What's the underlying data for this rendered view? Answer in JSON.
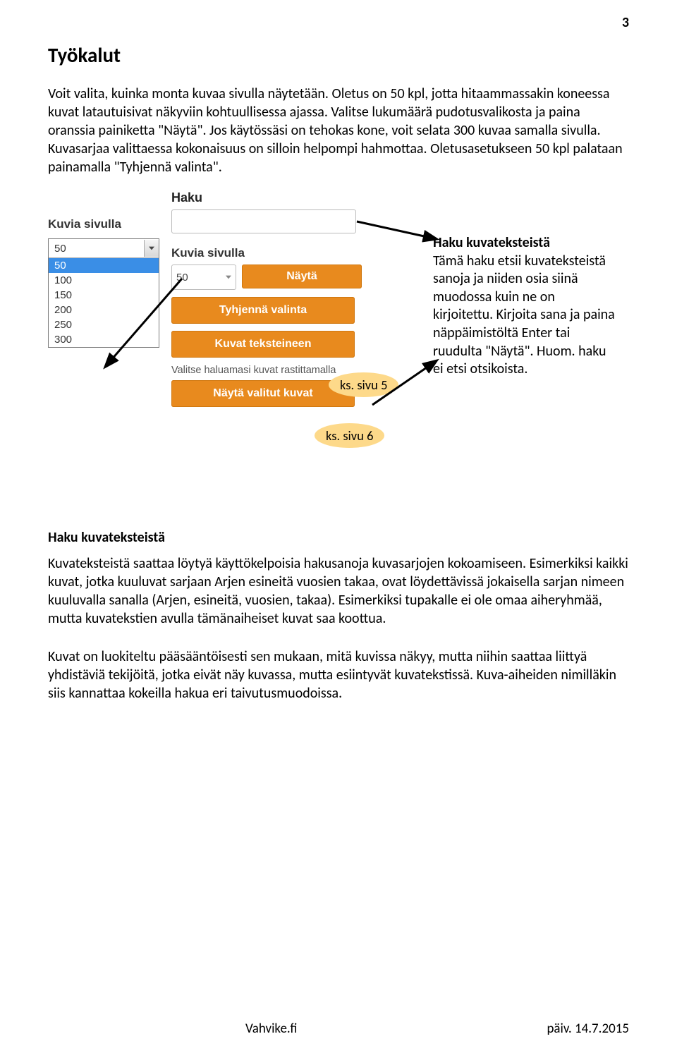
{
  "page_number": "3",
  "title": "Työkalut",
  "intro": "Voit valita, kuinka monta kuvaa sivulla näytetään. Oletus on 50 kpl, jotta hitaammassakin koneessa kuvat latautuisivat näkyviin kohtuullisessa ajassa. Valitse lukumäärä pudotusvalikosta ja paina oranssia painiketta \"Näytä\". Jos käytössäsi on tehokas kone, voit selata 300 kuvaa samalla sivulla. Kuvasarjaa valittaessa kokonaisuus on silloin helpompi hahmottaa. Oletusasetukseen 50 kpl palataan painamalla \"Tyhjennä valinta\".",
  "figure": {
    "left_label": "Kuvia sivulla",
    "select_value": "50",
    "options": [
      "50",
      "100",
      "150",
      "200",
      "250",
      "300"
    ],
    "haku_label": "Haku",
    "col_label": "Kuvia sivulla",
    "ctrl_select_value": "50",
    "btn_nayta": "Näytä",
    "btn_tyhjenna": "Tyhjennä valinta",
    "btn_kuvat_teksteineen": "Kuvat teksteineen",
    "helper": "Valitse haluamasi kuvat rastittamalla",
    "btn_nayta_valitut": "Näytä valitut kuvat",
    "callout1": "ks. sivu 5",
    "callout2": "ks. sivu 6",
    "side_note_heading": "Haku kuvateksteistä",
    "side_note_body": "Tämä haku etsii kuva­teksteistä sanoja ja niiden osia siinä muodossa kuin ne on kirjoitettu. Kirjoita sana ja paina näppäimistöltä Enter tai ruudulta \"Näytä\".\nHuom. haku ei etsi otsikoista."
  },
  "section2_heading": "Haku kuvateksteistä",
  "section2_p1": "Kuvateksteistä saattaa löytyä käyttökelpoisia hakusanoja kuvasarjojen kokoamiseen. Esimerkiksi kaikki kuvat, jotka kuuluvat sarjaan Arjen esineitä vuosien takaa, ovat löydettävissä jokaisella sarjan nimeen kuuluvalla sanalla (Arjen, esineitä, vuosien, takaa). Esimerkiksi tupakalle ei ole omaa aiheryhmää, mutta kuvatekstien avulla tämänaiheiset kuvat saa koottua.",
  "section2_p2": "Kuvat on luokiteltu pääsääntöisesti sen mukaan, mitä kuvissa näkyy, mutta niihin saattaa liittyä yhdistäviä tekijöitä, jotka eivät näy kuvassa, mutta esiintyvät kuvatekstissä. Kuva-aiheiden nimilläkin siis kannattaa kokeilla hakua eri taivutusmuodoissa.",
  "footer_site": "Vahvike.fi",
  "footer_date": "päiv. 14.7.2015"
}
